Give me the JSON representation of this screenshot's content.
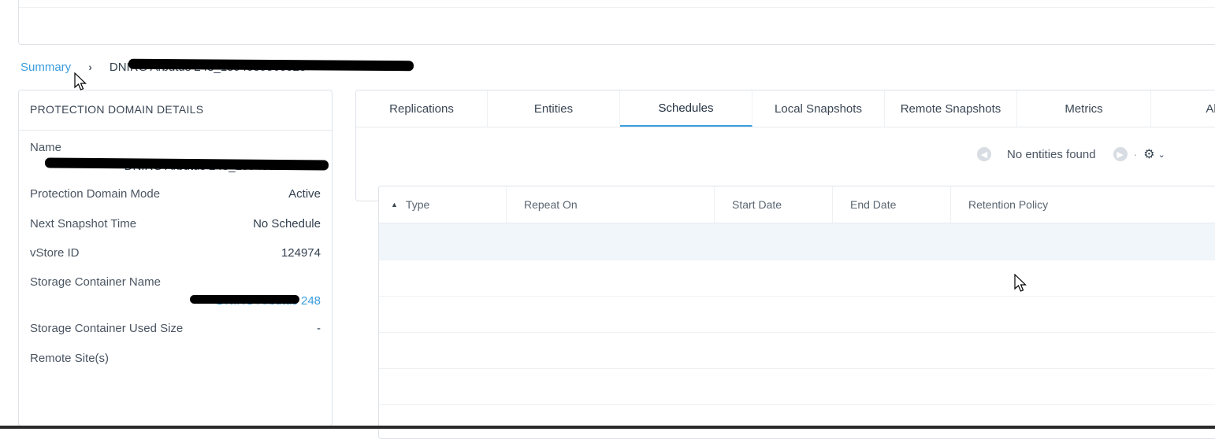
{
  "breadcrumb": {
    "root": "Summary",
    "separator": "›",
    "current": "DNIRG Arbutus 248_1594059560023"
  },
  "details": {
    "title": "PROTECTION DOMAIN DETAILS",
    "rows": [
      {
        "label": "Name",
        "value": "DNIRG Arbutus 248_1594059560023"
      },
      {
        "label": "Protection Domain Mode",
        "value": "Active"
      },
      {
        "label": "Next Snapshot Time",
        "value": "No Schedule"
      },
      {
        "label": "vStore ID",
        "value": "124974"
      },
      {
        "label": "Storage Container Name",
        "value": "DNIRG Arbutus 248"
      },
      {
        "label": "Storage Container Used Size",
        "value": "-"
      },
      {
        "label": "Remote Site(s)",
        "value": ""
      }
    ]
  },
  "tabs": [
    {
      "label": "Replications"
    },
    {
      "label": "Entities"
    },
    {
      "label": "Schedules"
    },
    {
      "label": "Local Snapshots"
    },
    {
      "label": "Remote Snapshots"
    },
    {
      "label": "Metrics"
    },
    {
      "label": "Ale"
    }
  ],
  "pager": {
    "status": "No entities found",
    "prev_icon": "chevron-left-icon",
    "next_icon": "chevron-right-icon",
    "settings_icon": "gear-icon"
  },
  "table": {
    "columns": [
      "Type",
      "Repeat On",
      "Start Date",
      "End Date",
      "Retention Policy"
    ]
  },
  "colors": {
    "accent": "#3b9ddd",
    "border": "#dfe3e8",
    "text": "#33404f"
  }
}
